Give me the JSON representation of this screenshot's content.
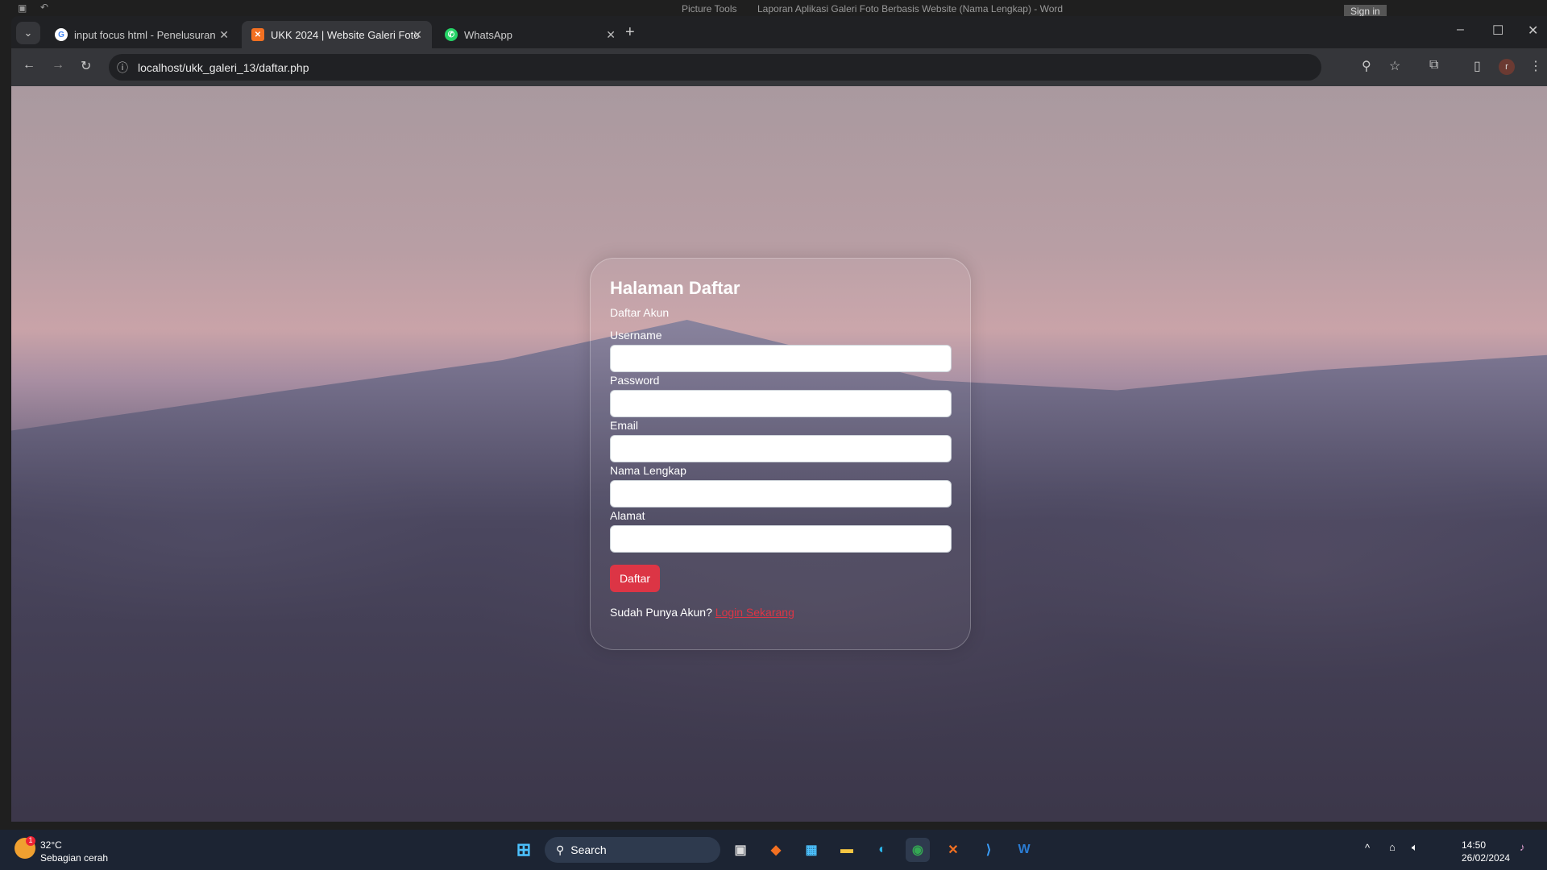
{
  "word": {
    "picture_tools": "Picture Tools",
    "title": "Laporan Aplikasi Galeri Foto Berbasis Website (Nama Lengkap)  -  Word",
    "sign_in": "Sign in"
  },
  "browser": {
    "tabs": [
      {
        "title": "input focus html - Penelusuran",
        "icon": "google-icon"
      },
      {
        "title": "UKK 2024 | Website Galeri Foto",
        "icon": "xampp-icon",
        "active": true
      },
      {
        "title": "WhatsApp",
        "icon": "whatsapp-icon"
      }
    ],
    "url": "localhost/ukk_galeri_13/daftar.php",
    "profile_initial": "r"
  },
  "page": {
    "title": "Halaman Daftar",
    "subtitle": "Daftar Akun",
    "fields": [
      {
        "label": "Username",
        "value": ""
      },
      {
        "label": "Password",
        "value": ""
      },
      {
        "label": "Email",
        "value": ""
      },
      {
        "label": "Nama Lengkap",
        "value": ""
      },
      {
        "label": "Alamat",
        "value": ""
      }
    ],
    "submit_label": "Daftar",
    "login_prompt": "Sudah Punya Akun?",
    "login_link": "Login Sekarang",
    "colors": {
      "button": "#dc3545",
      "link": "#dc3545"
    }
  },
  "taskbar": {
    "weather_temp": "32°C",
    "weather_desc": "Sebagian cerah",
    "weather_badge": "1",
    "search_placeholder": "Search",
    "time": "14:50",
    "date": "26/02/2024"
  }
}
